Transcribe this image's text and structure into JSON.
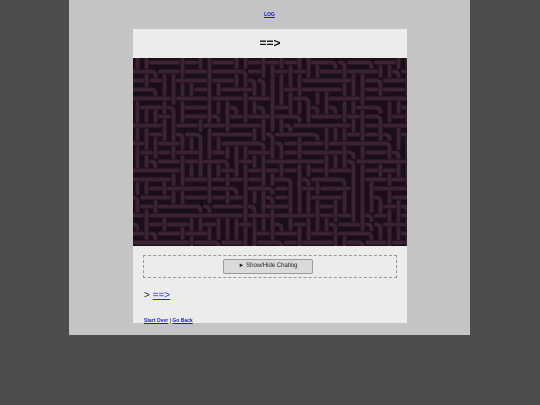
{
  "header": {
    "log_link": "LOG"
  },
  "passage": {
    "title": "==>"
  },
  "chatlog": {
    "toggle_label": "► Show/Hide Chatlog"
  },
  "navigation": {
    "prompt_symbol": ">",
    "next_link": "==>",
    "start_over": "Start Over",
    "separator": "|",
    "go_back": "Go Back"
  },
  "colors": {
    "page_background": "#4d4d4d",
    "frame_background": "#c4c4c4",
    "panel_background": "#ececec",
    "maze_background": "#1a0f18",
    "maze_walls": "#3a2233",
    "link_color": "#2a2ae0"
  }
}
